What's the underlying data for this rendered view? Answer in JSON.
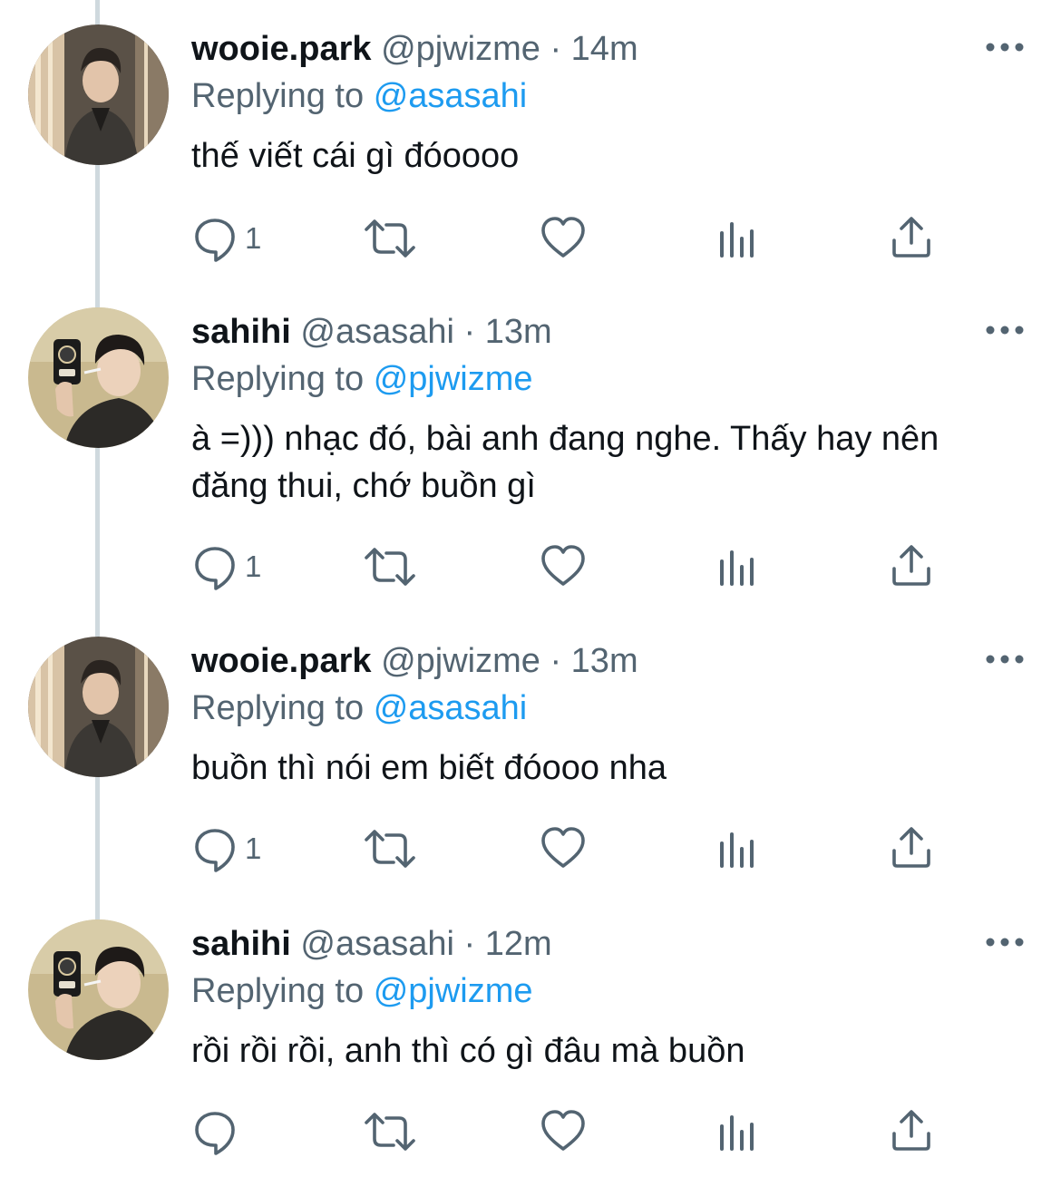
{
  "tweets": [
    {
      "name": "wooie.park",
      "handle": "@pjwizme",
      "separator": "·",
      "time": "14m",
      "replying_label": "Replying to",
      "replying_to": "@asasahi",
      "body": "thế viết cái gì đóoooo",
      "reply_count": "1",
      "avatar": "wooie-park-avatar"
    },
    {
      "name": "sahihi",
      "handle": "@asasahi",
      "separator": "·",
      "time": "13m",
      "replying_label": "Replying to",
      "replying_to": "@pjwizme",
      "body": "à =))) nhạc đó, bài anh đang nghe. Thấy hay nên đăng thui, chớ buồn gì",
      "reply_count": "1",
      "avatar": "sahihi-avatar"
    },
    {
      "name": "wooie.park",
      "handle": "@pjwizme",
      "separator": "·",
      "time": "13m",
      "replying_label": "Replying to",
      "replying_to": "@asasahi",
      "body": "buồn thì nói em biết đóooo nha",
      "reply_count": "1",
      "avatar": "wooie-park-avatar"
    },
    {
      "name": "sahihi",
      "handle": "@asasahi",
      "separator": "·",
      "time": "12m",
      "replying_label": "Replying to",
      "replying_to": "@pjwizme",
      "body": "rồi rồi rồi, anh thì có gì đâu mà buồn",
      "reply_count": "",
      "avatar": "sahihi-avatar"
    }
  ],
  "icons": {
    "reply": "reply-icon",
    "retweet": "retweet-icon",
    "like": "heart-icon",
    "views": "analytics-icon",
    "share": "share-icon",
    "more": "more-icon"
  },
  "colors": {
    "text": "#0f1419",
    "secondary": "#536471",
    "accent": "#1d9bf0",
    "thread_line": "#cfd9de"
  }
}
